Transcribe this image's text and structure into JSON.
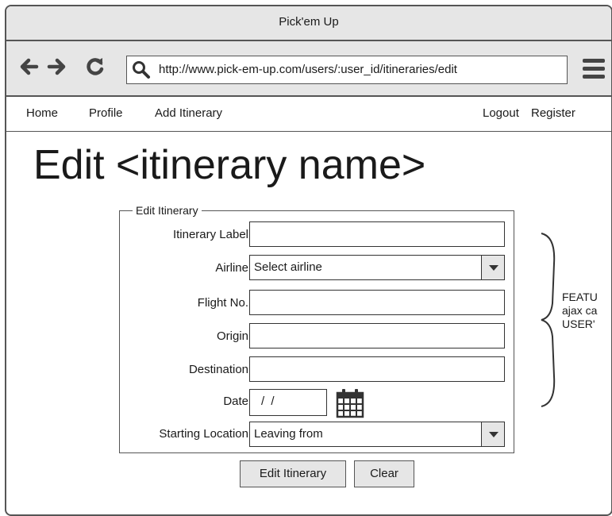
{
  "window": {
    "title": "Pick'em Up"
  },
  "browser": {
    "url": "http://www.pick-em-up.com/users/:user_id/itineraries/edit"
  },
  "nav": {
    "home": "Home",
    "profile": "Profile",
    "add_itinerary": "Add Itinerary",
    "logout": "Logout",
    "register": "Register"
  },
  "page": {
    "title": "Edit <itinerary name>"
  },
  "form": {
    "legend": "Edit Itinerary",
    "itinerary_label": {
      "label": "Itinerary Label",
      "value": ""
    },
    "airline": {
      "label": "Airline",
      "value": "Select airline"
    },
    "flight_no": {
      "label": "Flight No.",
      "value": ""
    },
    "origin": {
      "label": "Origin",
      "value": ""
    },
    "destination": {
      "label": "Destination",
      "value": ""
    },
    "date": {
      "label": "Date",
      "value": "/ /"
    },
    "starting_location": {
      "label": "Starting Location",
      "value": "Leaving from"
    }
  },
  "buttons": {
    "submit": "Edit Itinerary",
    "clear": "Clear"
  },
  "note": {
    "lines": [
      "FEATU",
      "ajax ca",
      "USER'"
    ]
  },
  "icons": {
    "back": "arrow-left-icon",
    "forward": "arrow-right-icon",
    "reload": "reload-icon",
    "search": "search-icon",
    "menu": "hamburger-menu-icon",
    "calendar": "calendar-icon"
  }
}
